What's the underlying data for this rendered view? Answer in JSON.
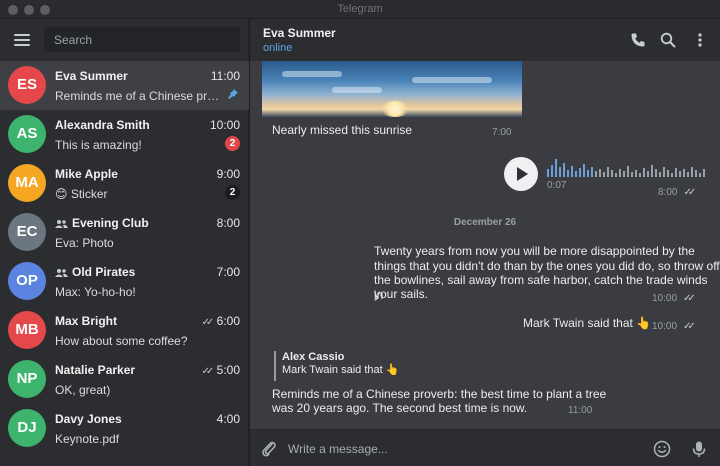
{
  "window": {
    "title": "Telegram"
  },
  "sidebar": {
    "search_placeholder": "Search",
    "chats": [
      {
        "initials": "ES",
        "color": "#e4484b",
        "name": "Eva Summer",
        "time": "11:00",
        "preview": "Reminds me of a Chinese prover…",
        "pinned": true,
        "active": true
      },
      {
        "initials": "AS",
        "color": "#3db46d",
        "name": "Alexandra Smith",
        "time": "10:00",
        "preview": "This is amazing!",
        "badge": "2",
        "badge_color": "red"
      },
      {
        "initials": "MA",
        "color": "#f5a623",
        "name": "Mike Apple",
        "time": "9:00",
        "preview": "😊 Sticker",
        "badge": "2",
        "badge_color": "dark"
      },
      {
        "initials": "EC",
        "color": "#6c7680",
        "name": "Evening Club",
        "group": true,
        "time": "8:00",
        "preview": "Eva: Photo"
      },
      {
        "initials": "OP",
        "color": "#5b84e0",
        "name": "Old Pirates",
        "group": true,
        "time": "7:00",
        "preview": "Max: Yo-ho-ho!"
      },
      {
        "initials": "MB",
        "color": "#e4484b",
        "name": "Max Bright",
        "time": "6:00",
        "read": true,
        "preview": "How about some coffee?"
      },
      {
        "initials": "NP",
        "color": "#3db46d",
        "name": "Natalie Parker",
        "time": "5:00",
        "read": true,
        "preview": "OK, great)"
      },
      {
        "initials": "DJ",
        "color": "#3db46d",
        "name": "Davy Jones",
        "time": "4:00",
        "preview": "Keynote.pdf"
      }
    ]
  },
  "chat": {
    "peer_name": "Eva Summer",
    "peer_status": "online",
    "photo_caption": "Nearly missed this sunrise",
    "photo_time": "7:00",
    "voice_duration": "0:07",
    "voice_time": "8:00",
    "date_separator": "December 26",
    "quote_line1": "Twenty years from now you will be more disappointed by the",
    "quote_line2": "things that you didn't do than by the ones you did do, so throw off",
    "quote_line3": "the bowlines, sail away from safe harbor, catch the trade winds in",
    "quote_line4": "your sails.",
    "quote_time": "10:00",
    "twain_msg": "Mark Twain said that 👆",
    "twain_time": "10:00",
    "reply_author": "Alex Cassio",
    "reply_text": "Mark Twain said that 👆",
    "proverb_line1": "Reminds me of a Chinese proverb: the best time to plant a tree",
    "proverb_line2": "was 20 years ago. The second best time is now.",
    "proverb_time": "11:00",
    "input_placeholder": "Write a message..."
  },
  "icons": {
    "call": "phone-icon",
    "search": "search-icon",
    "more": "more-vertical-icon",
    "attach": "paperclip-icon",
    "emoji": "smile-icon",
    "mic": "microphone-icon"
  }
}
